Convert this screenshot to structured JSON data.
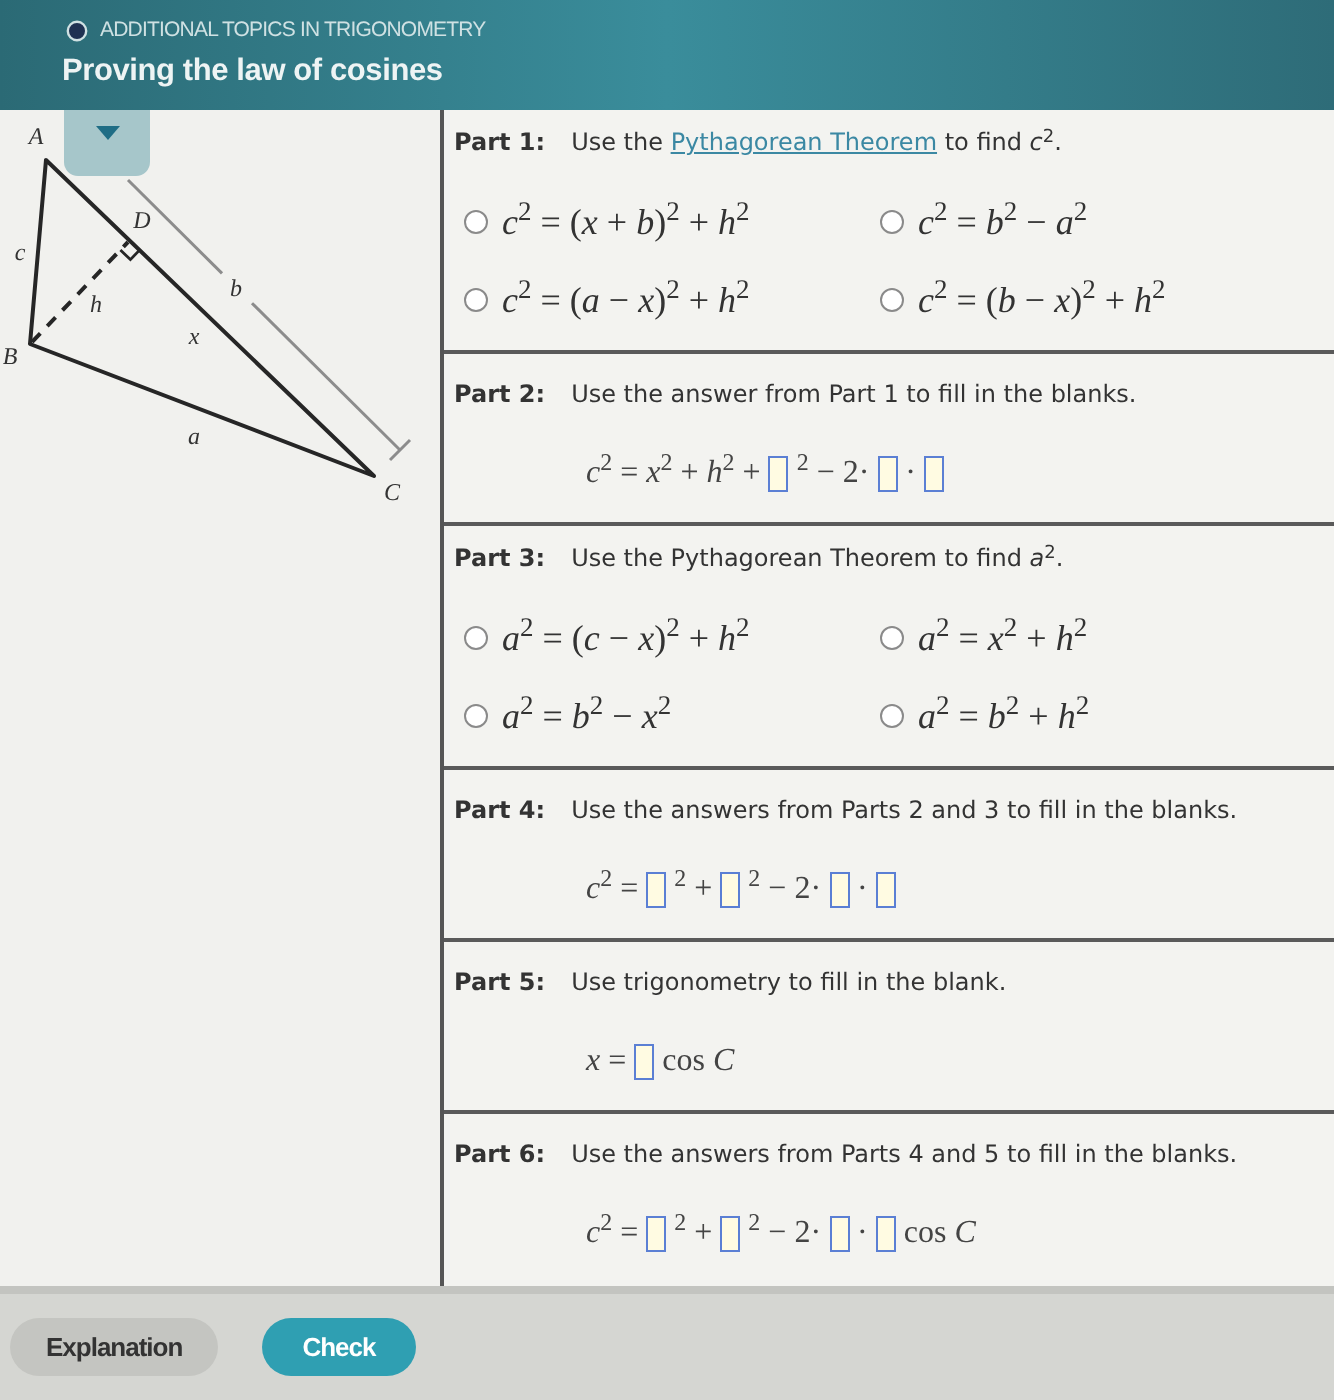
{
  "header": {
    "topic": "ADDITIONAL TOPICS IN TRIGONOMETRY",
    "title": "Proving the law of cosines"
  },
  "diagram": {
    "vertex_labels": [
      "A",
      "B",
      "C",
      "D"
    ],
    "side_labels": [
      "c",
      "h",
      "b",
      "x",
      "a"
    ]
  },
  "parts": [
    {
      "kind": "choice",
      "label": "Part 1:",
      "prompt": [
        {
          "kind": "text",
          "text": "Use the "
        },
        {
          "kind": "link",
          "text": "Pythagorean Theorem"
        },
        {
          "kind": "text",
          "text": " to find *c*$^{2}$."
        }
      ],
      "options": [
        {
          "text": "*c*$^{2}$ = (*x* + *b*)$^{2}$ + *h*$^{2}$",
          "selected": false
        },
        {
          "text": "*c*$^{2}$ = *b*$^{2}$ − *a*$^{2}$",
          "selected": false
        },
        {
          "text": "*c*$^{2}$ = (*a* − *x*)$^{2}$ + *h*$^{2}$",
          "selected": false
        },
        {
          "text": "*c*$^{2}$ = (*b* − *x*)$^{2}$ + *h*$^{2}$",
          "selected": false
        }
      ]
    },
    {
      "kind": "fill",
      "label": "Part 2:",
      "prompt": [
        {
          "kind": "text",
          "text": "Use the answer from Part 1 to fill in the blanks."
        }
      ],
      "equation": [
        {
          "kind": "math",
          "text": "*c*$^{2}$ = *x*$^{2}$ + *h*$^{2}$ +"
        },
        {
          "kind": "blank"
        },
        {
          "kind": "math",
          "text": "$^{2}$ − 2·"
        },
        {
          "kind": "blank"
        },
        {
          "kind": "math",
          "text": "·"
        },
        {
          "kind": "blank"
        }
      ]
    },
    {
      "kind": "choice",
      "label": "Part 3:",
      "prompt": [
        {
          "kind": "text",
          "text": "Use the Pythagorean Theorem to find *a*$^{2}$."
        }
      ],
      "options": [
        {
          "text": "*a*$^{2}$ = (*c* − *x*)$^{2}$ + *h*$^{2}$",
          "selected": false
        },
        {
          "text": "*a*$^{2}$ = *x*$^{2}$ + *h*$^{2}$",
          "selected": false
        },
        {
          "text": "*a*$^{2}$ = *b*$^{2}$ − *x*$^{2}$",
          "selected": false
        },
        {
          "text": "*a*$^{2}$ = *b*$^{2}$ + *h*$^{2}$",
          "selected": false
        }
      ]
    },
    {
      "kind": "fill",
      "label": "Part 4:",
      "prompt": [
        {
          "kind": "text",
          "text": "Use the answers from Parts 2 and 3 to fill in the blanks."
        }
      ],
      "equation": [
        {
          "kind": "math",
          "text": "*c*$^{2}$ ="
        },
        {
          "kind": "blank"
        },
        {
          "kind": "math",
          "text": "$^{2}$ +"
        },
        {
          "kind": "blank"
        },
        {
          "kind": "math",
          "text": "$^{2}$ − 2·"
        },
        {
          "kind": "blank"
        },
        {
          "kind": "math",
          "text": "·"
        },
        {
          "kind": "blank"
        }
      ]
    },
    {
      "kind": "fill",
      "label": "Part 5:",
      "prompt": [
        {
          "kind": "text",
          "text": "Use trigonometry to fill in the blank."
        }
      ],
      "equation": [
        {
          "kind": "math",
          "text": "*x* ="
        },
        {
          "kind": "blank"
        },
        {
          "kind": "math",
          "text": "cos *C*"
        }
      ]
    },
    {
      "kind": "fill",
      "label": "Part 6:",
      "prompt": [
        {
          "kind": "text",
          "text": "Use the answers from Parts 4 and 5 to fill in the blanks."
        }
      ],
      "equation": [
        {
          "kind": "math",
          "text": "*c*$^{2}$ ="
        },
        {
          "kind": "blank"
        },
        {
          "kind": "math",
          "text": "$^{2}$ +"
        },
        {
          "kind": "blank"
        },
        {
          "kind": "math",
          "text": "$^{2}$ − 2·"
        },
        {
          "kind": "blank"
        },
        {
          "kind": "math",
          "text": "·"
        },
        {
          "kind": "blank"
        },
        {
          "kind": "math",
          "text": "cos *C*"
        }
      ]
    }
  ],
  "buttons": [
    {
      "label": "Explanation",
      "kind": "secondary"
    },
    {
      "label": "Check",
      "kind": "primary"
    }
  ]
}
